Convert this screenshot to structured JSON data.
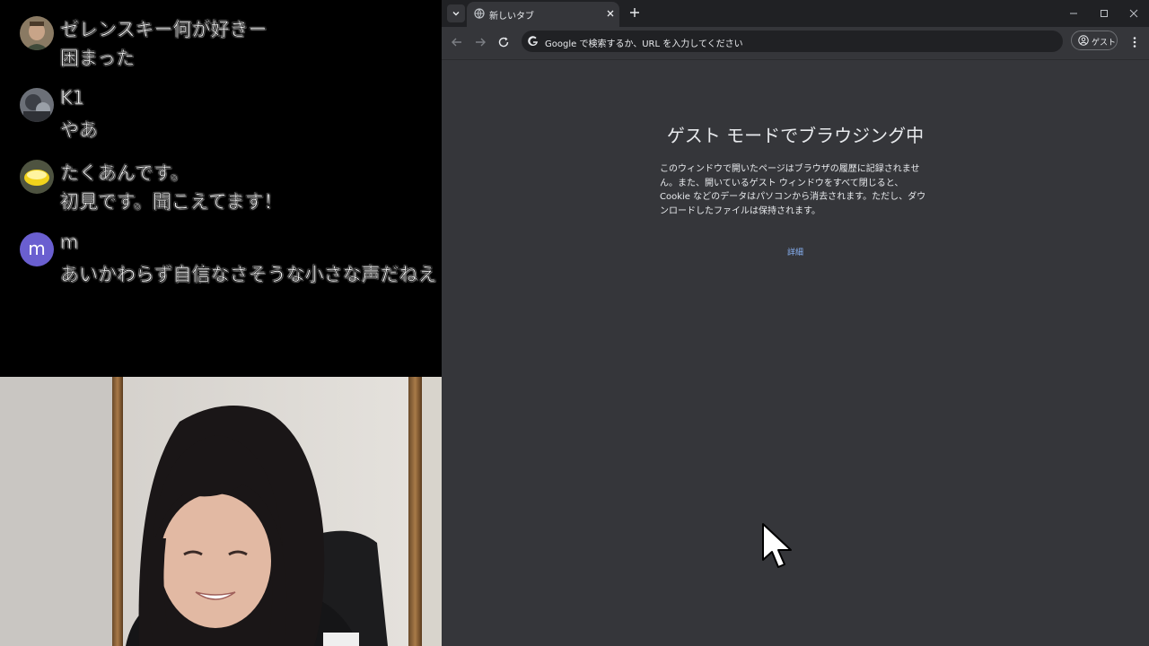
{
  "chat": {
    "messages": [
      {
        "name": "ゼレンスキー何が好きー",
        "text": "困まった"
      },
      {
        "name": "K1",
        "text": "やあ"
      },
      {
        "name": "たくあんです。",
        "text": "初見です。聞こえてます！"
      },
      {
        "name": "m",
        "text": "あいかわらず自信なさそうな小さな声だねえ",
        "avatar_letter": "m"
      }
    ]
  },
  "browser": {
    "tab_title": "新しいタブ",
    "omnibox_placeholder": "Google で検索するか、URL を入力してください",
    "profile_label": "ゲスト",
    "page": {
      "title": "ゲスト モードでブラウジング中",
      "description": "このウィンドウで開いたページはブラウザの履歴に記録されません。また、開いているゲスト ウィンドウをすべて閉じると、Cookie などのデータはパソコンから消去されます。ただし、ダウンロードしたファイルは保持されます。",
      "link": "詳細"
    }
  },
  "colors": {
    "browser_bg": "#35363a",
    "tabstrip_bg": "#202124",
    "link": "#8ab4f8",
    "avatar_m": "#6a5fd0"
  }
}
